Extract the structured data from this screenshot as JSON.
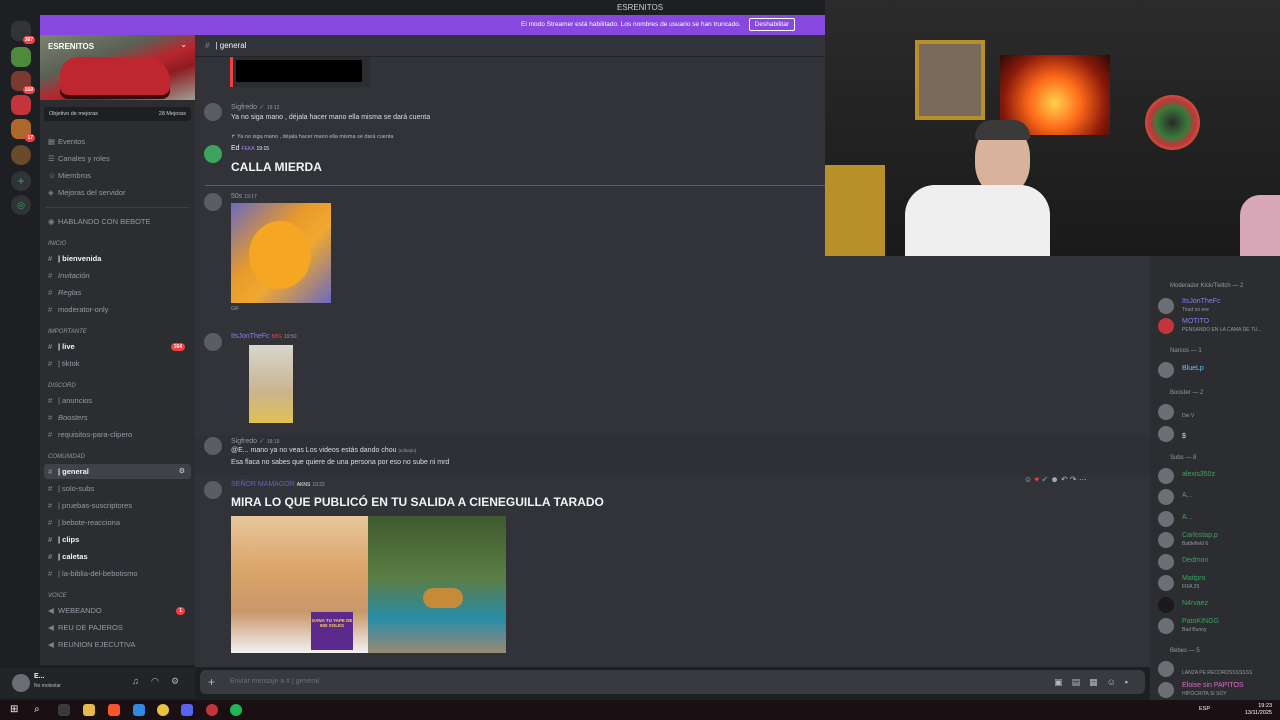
{
  "window": {
    "title": "ESRENITOS"
  },
  "streamer_bar": {
    "text": "El modo Streamer está habilitado. Los nombres de usuario se han truncado.",
    "button": "Deshabilitar"
  },
  "guild_badges": [
    "387",
    "159",
    "17"
  ],
  "server": {
    "name": "ESRENITOS",
    "boost_goal": "Objetivo de mejoras",
    "boost_count": "28 Mejoras",
    "menu": [
      "Eventos",
      "Canales y roles",
      "Miembros",
      "Mejoras del servidor"
    ],
    "talking": "HABLANDO CON BEBOTE",
    "categories": [
      "INICIO",
      "IMPORTANTE",
      "DISCORD",
      "COMUNIDAD",
      "VOICE"
    ],
    "channels": [
      {
        "name": "| bienvenida",
        "bold": true
      },
      {
        "name": "Invitación",
        "bold": false
      },
      {
        "name": "Reglas",
        "bold": false
      },
      {
        "name": "moderator-only",
        "bold": false
      },
      {
        "name": "| live",
        "bold": true,
        "badge": "164"
      },
      {
        "name": "| tiktok",
        "bold": false
      },
      {
        "name": "| anuncios",
        "bold": false
      },
      {
        "name": "Boosters",
        "bold": false
      },
      {
        "name": "requisitos-para-clipero",
        "bold": false
      },
      {
        "name": "| general",
        "bold": true
      },
      {
        "name": "| solo-subs",
        "bold": false
      },
      {
        "name": "| pruebas-suscriptores",
        "bold": false
      },
      {
        "name": "| bebote-reacciona",
        "bold": false
      },
      {
        "name": "| clips",
        "bold": true
      },
      {
        "name": "| caletas",
        "bold": true
      },
      {
        "name": "| la-biblia-del-bebotismo",
        "bold": false
      },
      {
        "name": "WEBEANDO",
        "bold": false,
        "badge": "1"
      },
      {
        "name": "REU DE PAJEROS",
        "bold": false
      },
      {
        "name": "REUNION EJECUTIVA",
        "bold": false
      }
    ]
  },
  "user_panel": {
    "name": "E...",
    "status": "No molestar"
  },
  "channel_header": {
    "name": "| general"
  },
  "messages": [
    {
      "author": "Sigfredo",
      "time": "19:12",
      "text": "Ya no siga mano , déjala hacer mano ella misma se dará cuenta"
    },
    {
      "reply": "Ya no siga mano , déjala hacer mano ella misma se dará cuenta",
      "author": "Ed",
      "tag": "FEKA",
      "time": "19:15",
      "text": "CALLA MIERDA"
    },
    {
      "author": "50s",
      "time": "19:17",
      "text": "GIF"
    },
    {
      "author": "ItsJonTheFc",
      "tag": "BBG",
      "time": "19:50",
      "text": ""
    },
    {
      "author": "Sigfredo",
      "time": "19:19",
      "reply": "@E... mano ya no veas Los videos estás dando chou",
      "edited": "(editado)",
      "text": "Esa flaca no sabes que quiere de una persona por eso no sube ni mrd"
    },
    {
      "author": "SEÑOR MAMAGOR",
      "tag": "AKNS",
      "time": "19:22",
      "text": "MIRA LO QUE PUBLICÓ EN TU SALIDA  A CIENEGUILLA TARADO",
      "image_caption": "GANA TU YAPE DE 500 SOLES"
    }
  ],
  "composer": {
    "placeholder": "Enviar mensaje a # | general"
  },
  "members": {
    "categories": [
      "Moderador Kick/Twitch — 2",
      "Narcos — 1",
      "Booster — 2",
      "Subs — 8",
      "Bebes — 5"
    ],
    "list": [
      {
        "name": "ItsJonTheFc",
        "sub": "Tirad no ere",
        "color": "#8e7cf0"
      },
      {
        "name": "MOTITO",
        "sub": "PENSANDO EN LA CAMA DE TU...",
        "color": "#8e7cf0"
      },
      {
        "name": "BlueLp",
        "sub": "",
        "color": "#63c4f0"
      },
      {
        "name": "",
        "sub": "Dei V",
        "color": "#8e7cf0"
      },
      {
        "name": "$",
        "sub": "",
        "color": "#dbdee1"
      },
      {
        "name": "alexis350z",
        "sub": "",
        "color": "#3ba55c"
      },
      {
        "name": "A...",
        "sub": "",
        "color": "#3ba55c"
      },
      {
        "name": "A...",
        "sub": "",
        "color": "#3ba55c"
      },
      {
        "name": "Carlostap.p",
        "sub": "Battlefield 6",
        "color": "#3ba55c"
      },
      {
        "name": "Dedmon",
        "sub": "",
        "color": "#3ba55c"
      },
      {
        "name": "Matipro",
        "sub": "FIFA 25",
        "color": "#3ba55c"
      },
      {
        "name": "N4rvaez",
        "sub": "",
        "color": "#3ba55c"
      },
      {
        "name": "PatoKINGG",
        "sub": "Bad Bunny",
        "color": "#3ba55c"
      },
      {
        "name": "",
        "sub": "LANZA PE RECORDSSSSSSS",
        "color": "#e06bd0"
      },
      {
        "name": "Eloise sin PAPITOS",
        "sub": "HIPÓCRITA SI SOY",
        "color": "#e06bd0"
      }
    ]
  },
  "tray": {
    "time": "19:23",
    "date": "13/11/2025",
    "lang": "ESP"
  }
}
